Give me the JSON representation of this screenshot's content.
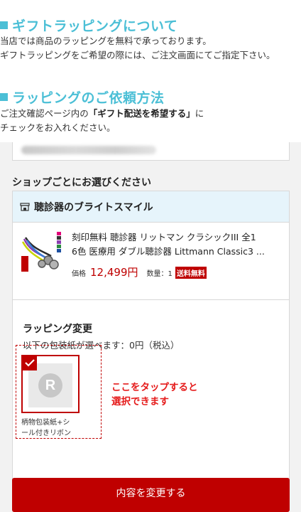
{
  "section1": {
    "title": "ギフトラッピングについて",
    "line1": "当店では商品のラッピングを無料で承っております。",
    "line2": "ギフトラッピングをご希望の際には、ご注文画面にてご指定下さい。"
  },
  "section2": {
    "title": "ラッピングのご依頼方法",
    "line1_pre": "ご注文確認ページ内の",
    "line1_bold": "「ギフト配送を希望する」",
    "line1_post": "に",
    "line2": "チェックをお入れください。"
  },
  "shop_select_title": "ショップごとにお選びください",
  "shop": {
    "icon": "shop-icon",
    "name": "聴診器のブライトスマイル"
  },
  "product": {
    "name_line1": "刻印無料 聴診器 リットマン クラシックIII 全1",
    "name_line2": "6色 医療用 ダブル聴診器 Littmann Classic3 ...",
    "price_label": "価格",
    "price": "12,499円",
    "qty": "数量：1",
    "shipping_badge": "送料無料"
  },
  "wrapping": {
    "title": "ラッピング変更",
    "subtitle": "以下の包装紙が選べます：0円（税込）",
    "option_logo": "R",
    "option_label_line1": "柄物包装紙+シ",
    "option_label_line2": "ール付きリボン",
    "option_selected": true
  },
  "annotation": {
    "line1": "ここをタップすると",
    "line2": "選択できます"
  },
  "submit_label": "内容を変更する",
  "colors": {
    "heading": "#4bbfd6",
    "accent_red": "#bf0000",
    "shop_header_bg": "#e6f4fb",
    "annotation": "#e51b1b"
  }
}
